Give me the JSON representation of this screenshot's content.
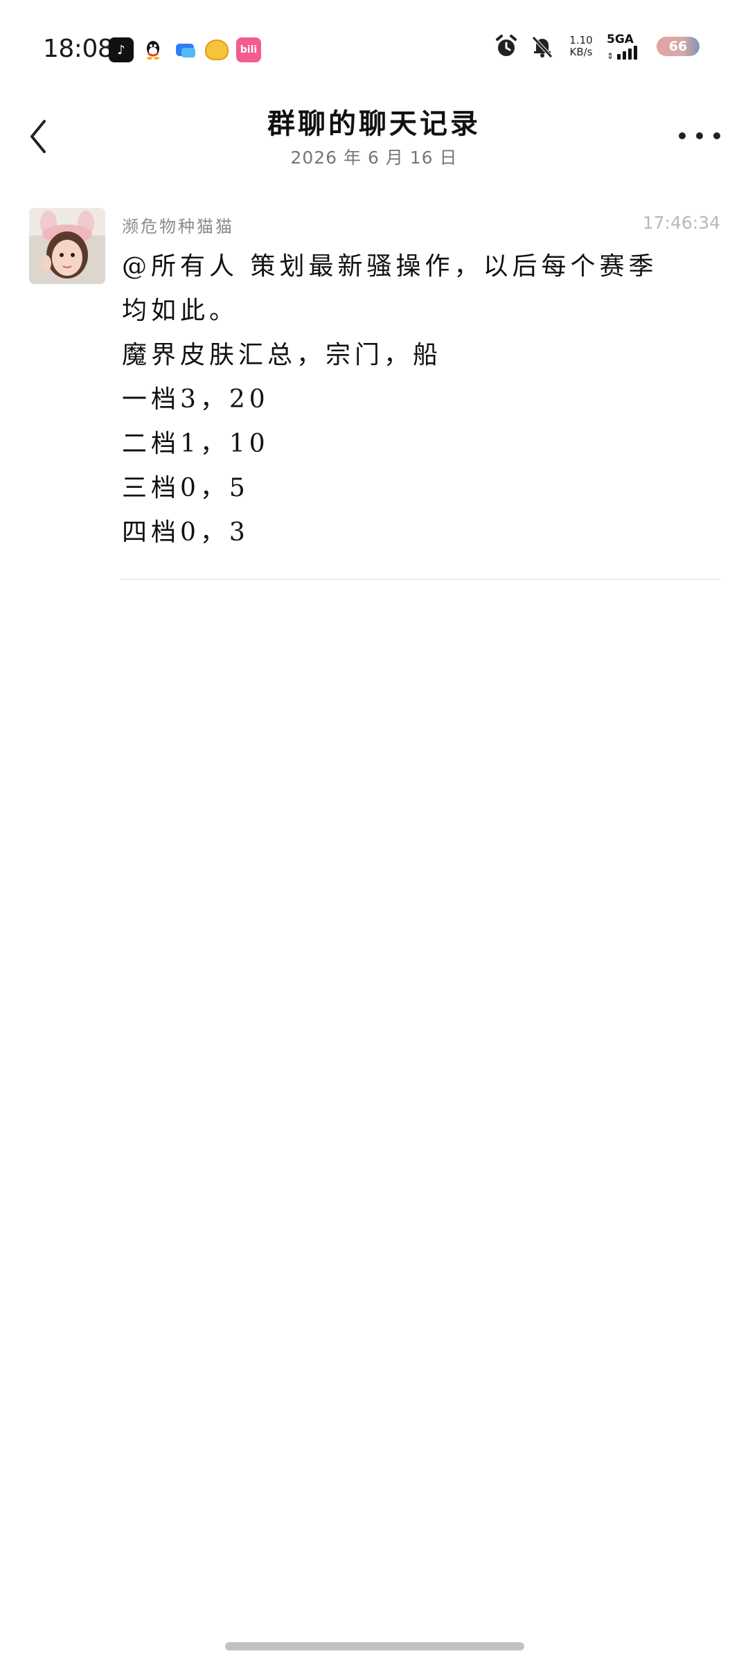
{
  "status_bar": {
    "time": "18:08",
    "apps": [
      "tiktok-icon",
      "qq-icon",
      "chat-app-icon",
      "bear-app-icon",
      "bilibili-icon"
    ],
    "bilibili_label": "bili",
    "net_speed_value": "1.10",
    "net_speed_unit": "KB/s",
    "signal_label": "5GA",
    "battery": "66"
  },
  "header": {
    "title": "群聊的聊天记录",
    "date": "2026 年 6 月 16 日"
  },
  "message": {
    "sender": "濒危物种猫猫",
    "time": "17:46:34",
    "lines": [
      "@所有人 策划最新骚操作，以后每个赛季",
      "均如此。",
      "魔界皮肤汇总，宗门，船",
      "一档3，20",
      "二档1，10",
      "三档0，5",
      "四档0，3"
    ]
  },
  "colors": {
    "background": "#ffffff",
    "secondary_text": "#8a8a8a",
    "timestamp_text": "#b8b8b8",
    "home_indicator": "#c2c2c2"
  }
}
